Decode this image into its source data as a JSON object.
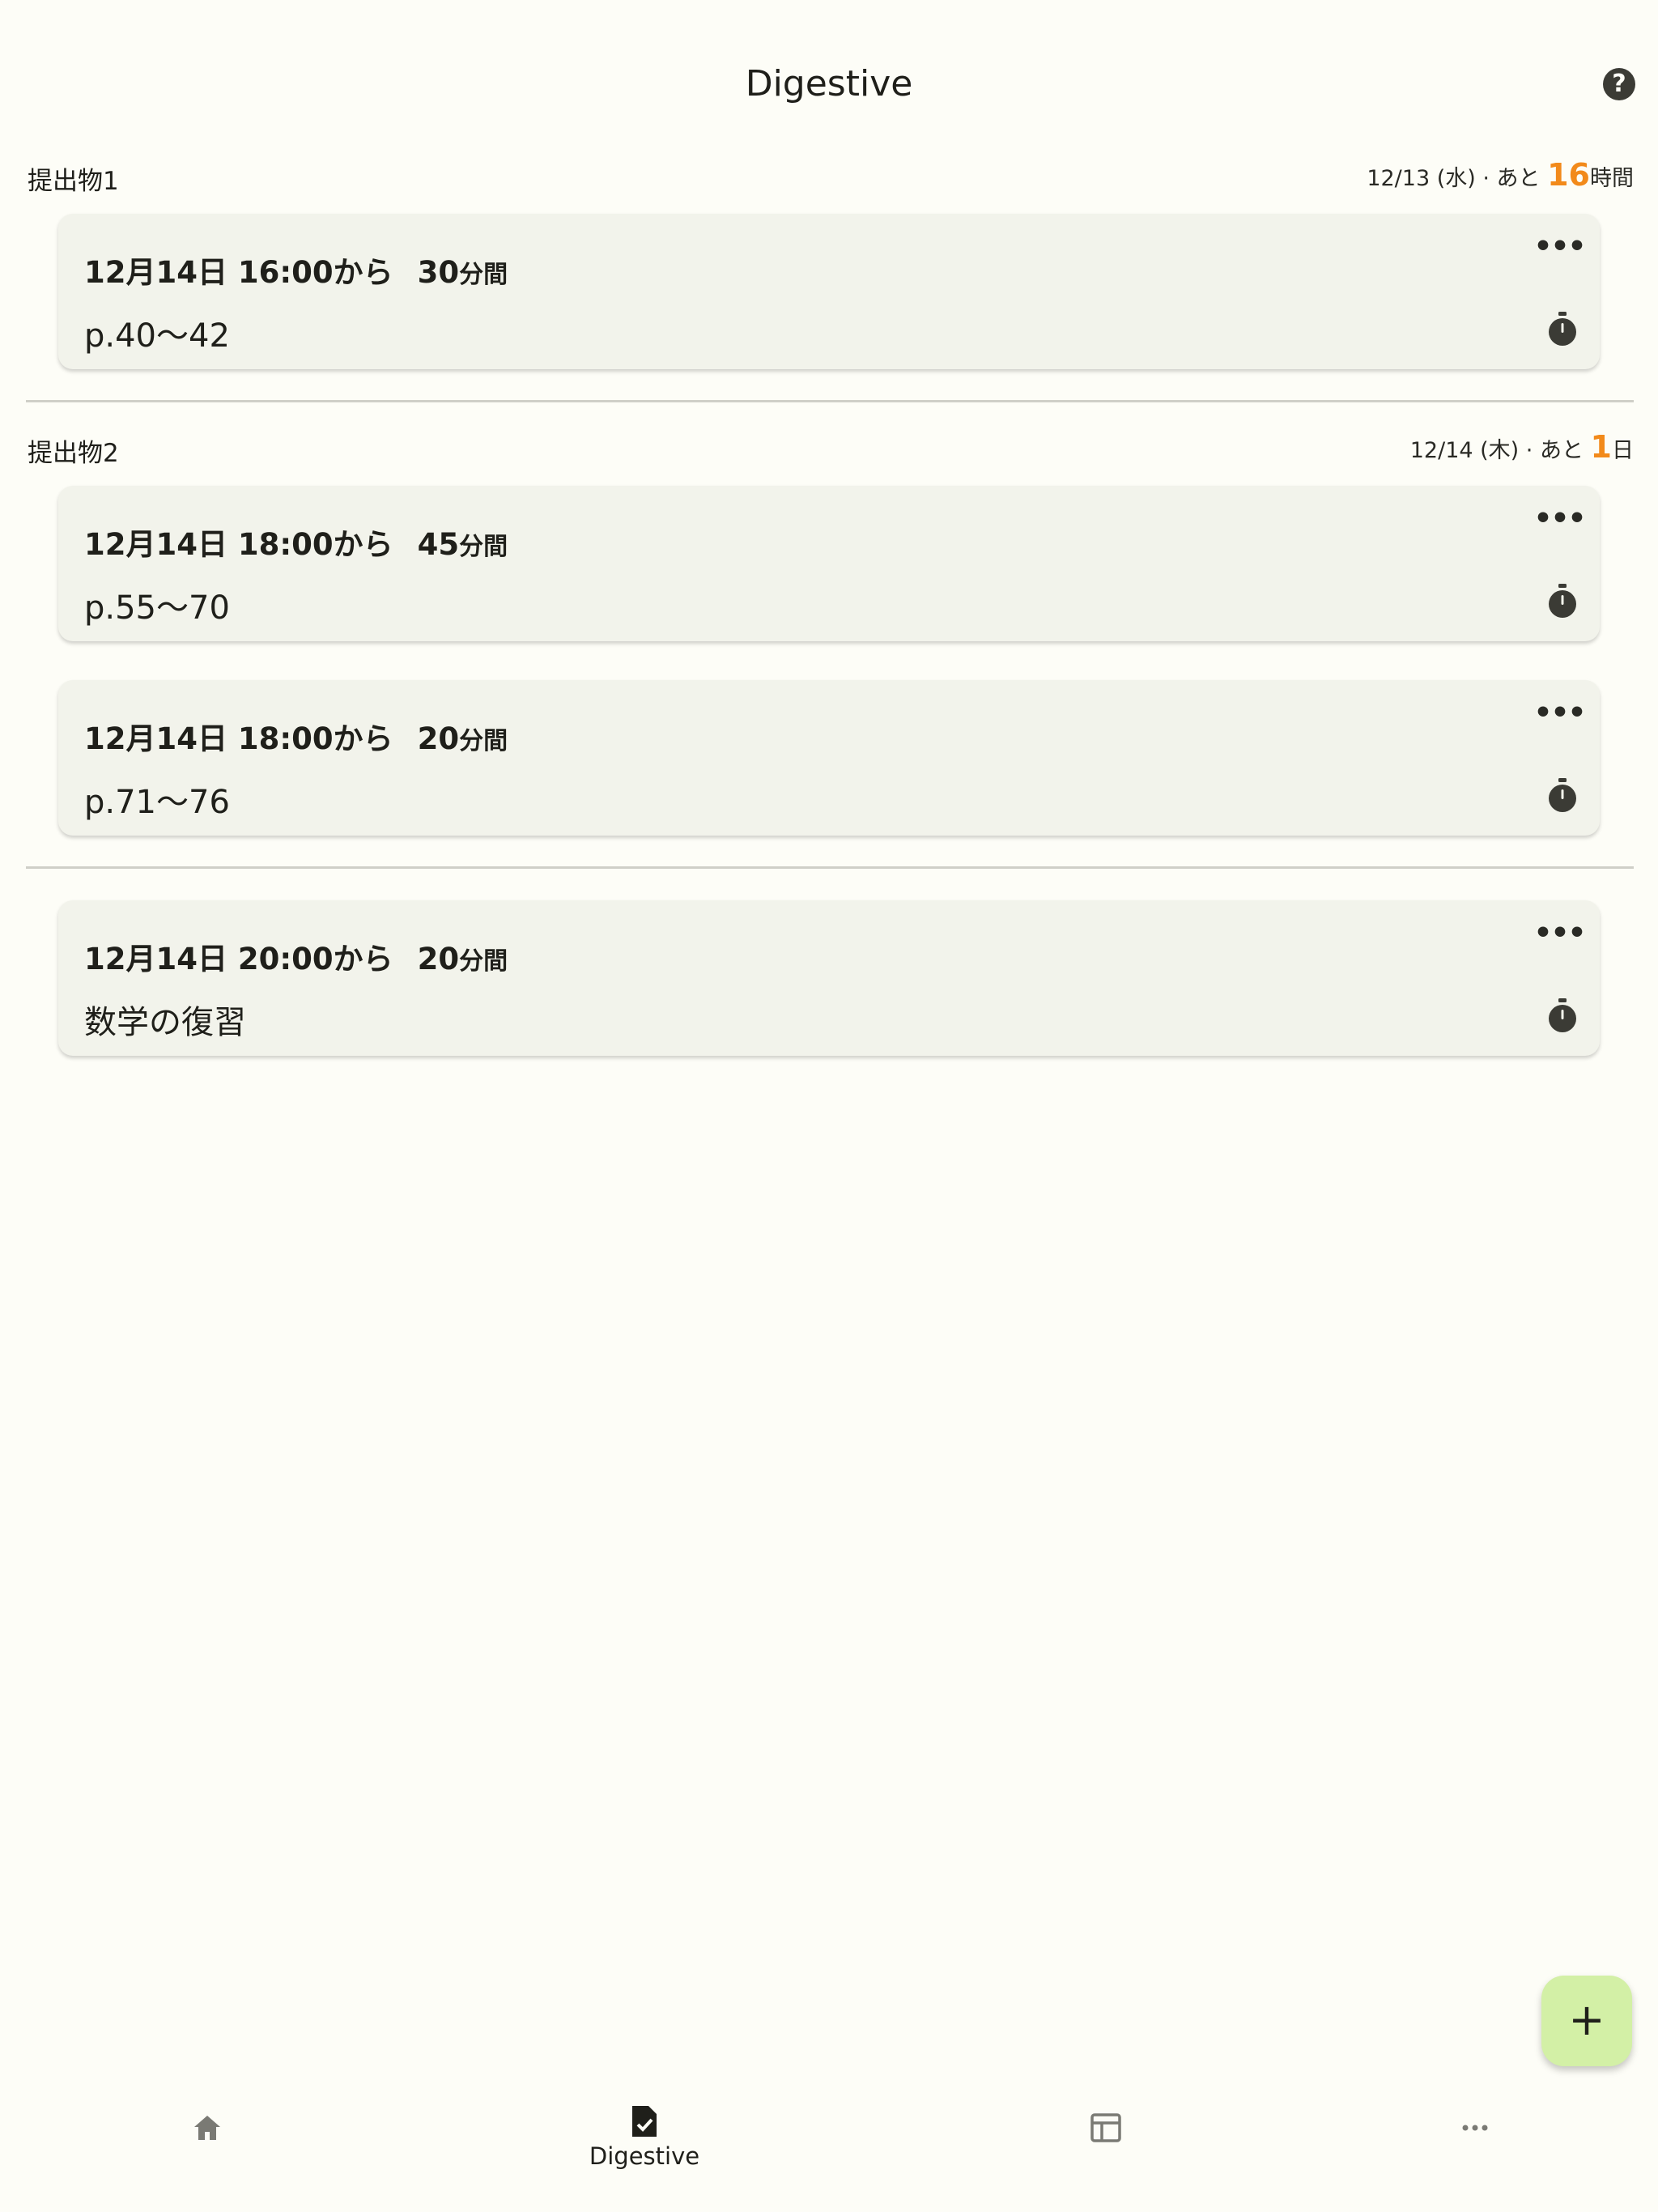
{
  "header": {
    "title": "Digestive",
    "help_icon": "help-circle-icon",
    "help_glyph": "?"
  },
  "groups": [
    {
      "title": "提出物1",
      "deadline_prefix": "12/13 (水) · あと ",
      "remain_value": "16",
      "remain_unit": "時間",
      "tasks": [
        {
          "date": "12月14日",
          "time": "16:00から",
          "duration": "30",
          "duration_unit": "分間",
          "detail": "p.40〜42"
        }
      ]
    },
    {
      "title": "提出物2",
      "deadline_prefix": "12/14 (木) · あと ",
      "remain_value": "1",
      "remain_unit": "日",
      "tasks": [
        {
          "date": "12月14日",
          "time": "18:00から",
          "duration": "45",
          "duration_unit": "分間",
          "detail": "p.55〜70"
        },
        {
          "date": "12月14日",
          "time": "18:00から",
          "duration": "20",
          "duration_unit": "分間",
          "detail": "p.71〜76"
        }
      ]
    }
  ],
  "ungrouped_tasks": [
    {
      "date": "12月14日",
      "time": "20:00から",
      "duration": "20",
      "duration_unit": "分間",
      "detail": "数学の復習"
    }
  ],
  "card_icons": {
    "more": "more-horizontal-icon",
    "more_glyph": "•••",
    "timer": "stopwatch-icon"
  },
  "accent_color": "#f28a1b",
  "fab": {
    "icon": "plus-icon",
    "glyph": "+",
    "color": "#d3f0a6"
  },
  "bottom_nav": [
    {
      "icon": "home-icon",
      "label": ""
    },
    {
      "icon": "task-document-check-icon",
      "label": "Digestive"
    },
    {
      "icon": "calendar-table-icon",
      "label": ""
    },
    {
      "icon": "more-horizontal-icon",
      "label": ""
    }
  ]
}
